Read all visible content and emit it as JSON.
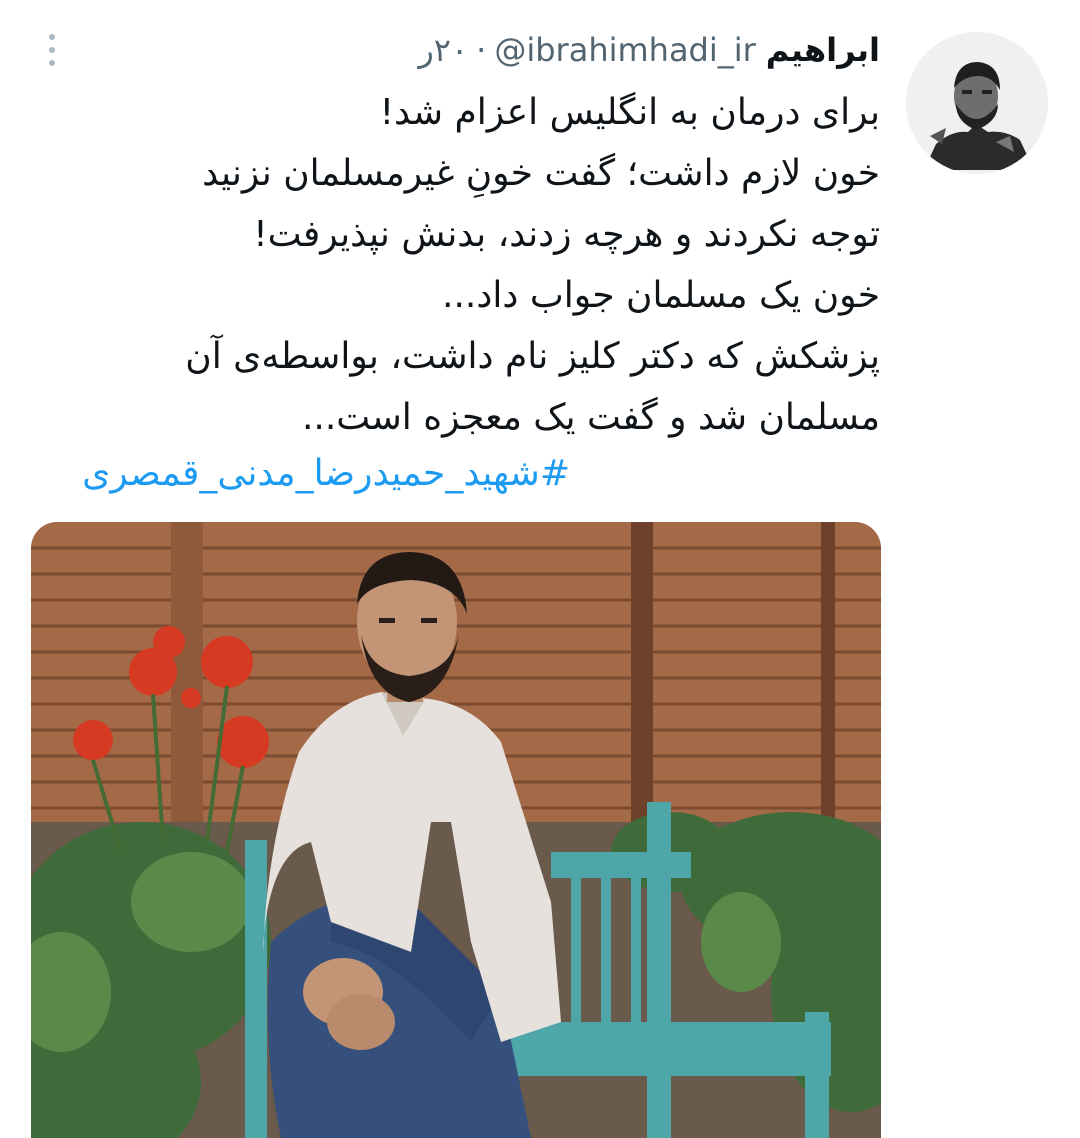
{
  "tweet": {
    "author": {
      "display_name": "ابراهیم",
      "handle": "@ibrahimhadi_ir",
      "separator": "·",
      "timestamp": "۲۰ر"
    },
    "lines": [
      "برای درمان به انگلیس اعزام شد!",
      "خون لازم داشت؛ گفت خونِ غیرمسلمان نزنید",
      "توجه نکردند و هرچه زدند، بدنش نپذیرفت!",
      "خون یک مسلمان جواب داد...",
      "پزشکش که دکتر کلیز نام داشت، بواسطه‌ی آن",
      "مسلمان شد و گفت یک معجزه است..."
    ],
    "hashtag": "#شهید_حمیدرضا_مدنی_قمصری",
    "more_icon": "more-vertical-icon",
    "colors": {
      "link": "#1d9bf0",
      "secondary_text": "#536471"
    }
  }
}
